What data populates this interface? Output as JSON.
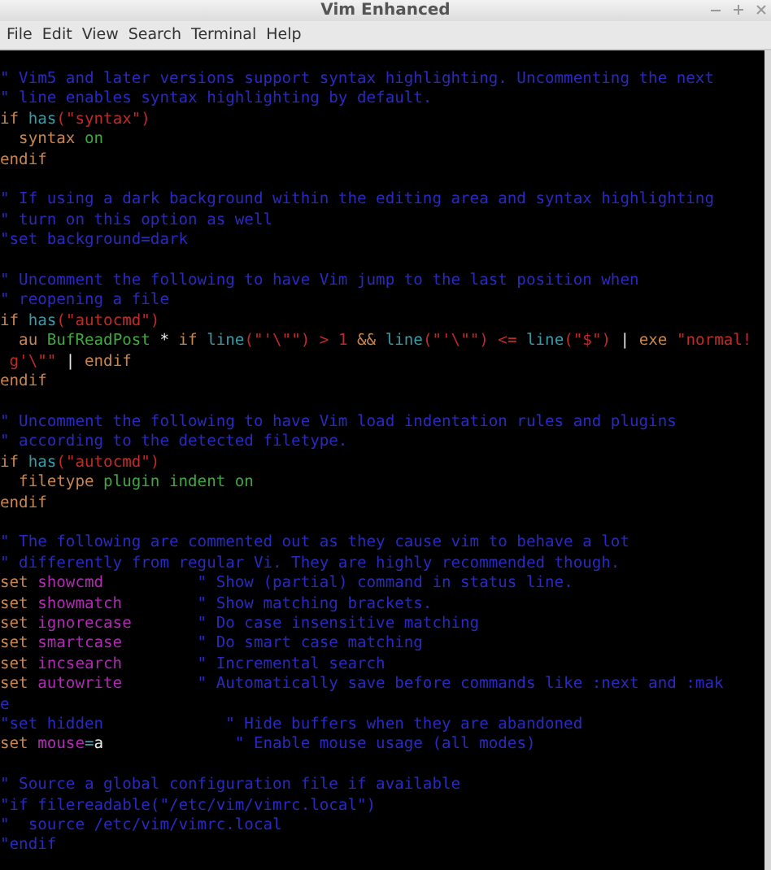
{
  "window": {
    "title": "Vim Enhanced"
  },
  "menu": [
    "File",
    "Edit",
    "View",
    "Search",
    "Terminal",
    "Help"
  ],
  "lines": [
    {
      "kind": "code",
      "tokens": [
        {
          "kind": "comment",
          "text": "\" Vim5 and later versions support syntax highlighting. Uncommenting the next"
        }
      ]
    },
    {
      "kind": "code",
      "tokens": [
        {
          "kind": "comment",
          "text": "\" line enables syntax highlighting by default."
        }
      ]
    },
    {
      "kind": "code",
      "tokens": [
        {
          "kind": "statement",
          "text": "if"
        },
        {
          "kind": "function",
          "text": " has"
        },
        {
          "kind": "string",
          "text": "(\"syntax\")"
        }
      ]
    },
    {
      "kind": "code",
      "tokens": [
        {
          "kind": "statement",
          "text": "  syntax"
        },
        {
          "kind": "constant",
          "text": " on"
        }
      ]
    },
    {
      "kind": "code",
      "tokens": [
        {
          "kind": "statement",
          "text": "endif"
        }
      ]
    },
    {
      "kind": "blank"
    },
    {
      "kind": "code",
      "tokens": [
        {
          "kind": "comment",
          "text": "\" If using a dark background within the editing area and syntax highlighting"
        }
      ]
    },
    {
      "kind": "code",
      "tokens": [
        {
          "kind": "comment",
          "text": "\" turn on this option as well"
        }
      ]
    },
    {
      "kind": "code",
      "tokens": [
        {
          "kind": "comment",
          "text": "\"set background=dark"
        }
      ]
    },
    {
      "kind": "blank"
    },
    {
      "kind": "code",
      "tokens": [
        {
          "kind": "comment",
          "text": "\" Uncomment the following to have Vim jump to the last position when"
        }
      ]
    },
    {
      "kind": "code",
      "tokens": [
        {
          "kind": "comment",
          "text": "\" reopening a file"
        }
      ]
    },
    {
      "kind": "code",
      "tokens": [
        {
          "kind": "statement",
          "text": "if"
        },
        {
          "kind": "function",
          "text": " has"
        },
        {
          "kind": "string",
          "text": "(\"autocmd\")"
        }
      ]
    },
    {
      "kind": "code",
      "tokens": [
        {
          "kind": "statement",
          "text": "  au"
        },
        {
          "kind": "constant",
          "text": " BufReadPost"
        },
        {
          "kind": "normal",
          "text": " *"
        },
        {
          "kind": "statement",
          "text": " if"
        },
        {
          "kind": "function",
          "text": " line"
        },
        {
          "kind": "string",
          "text": "(\"'\\\"\") > 1"
        },
        {
          "kind": "statement",
          "text": " &&"
        },
        {
          "kind": "function",
          "text": " line"
        },
        {
          "kind": "string",
          "text": "(\"'\\\"\") <="
        },
        {
          "kind": "function",
          "text": " line"
        },
        {
          "kind": "string",
          "text": "(\"$\")"
        },
        {
          "kind": "normal",
          "text": " |"
        },
        {
          "kind": "statement",
          "text": " exe"
        },
        {
          "kind": "string",
          "text": " \"normal!"
        }
      ]
    },
    {
      "kind": "code",
      "tokens": [
        {
          "kind": "string",
          "text": " g'\\\"\""
        },
        {
          "kind": "normal",
          "text": " |"
        },
        {
          "kind": "statement",
          "text": " endif"
        }
      ]
    },
    {
      "kind": "code",
      "tokens": [
        {
          "kind": "statement",
          "text": "endif"
        }
      ]
    },
    {
      "kind": "blank"
    },
    {
      "kind": "code",
      "tokens": [
        {
          "kind": "comment",
          "text": "\" Uncomment the following to have Vim load indentation rules and plugins"
        }
      ]
    },
    {
      "kind": "code",
      "tokens": [
        {
          "kind": "comment",
          "text": "\" according to the detected filetype."
        }
      ]
    },
    {
      "kind": "code",
      "tokens": [
        {
          "kind": "statement",
          "text": "if"
        },
        {
          "kind": "function",
          "text": " has"
        },
        {
          "kind": "string",
          "text": "(\"autocmd\")"
        }
      ]
    },
    {
      "kind": "code",
      "tokens": [
        {
          "kind": "statement",
          "text": "  filetype"
        },
        {
          "kind": "constant",
          "text": " plugin indent on"
        }
      ]
    },
    {
      "kind": "code",
      "tokens": [
        {
          "kind": "statement",
          "text": "endif"
        }
      ]
    },
    {
      "kind": "blank"
    },
    {
      "kind": "code",
      "tokens": [
        {
          "kind": "comment",
          "text": "\" The following are commented out as they cause vim to behave a lot"
        }
      ]
    },
    {
      "kind": "code",
      "tokens": [
        {
          "kind": "comment",
          "text": "\" differently from regular Vi. They are highly recommended though."
        }
      ]
    },
    {
      "kind": "code",
      "tokens": [
        {
          "kind": "statement",
          "text": "set"
        },
        {
          "kind": "option",
          "text": " showcmd"
        },
        {
          "kind": "comment",
          "text": "          \" Show (partial) command in status line."
        }
      ]
    },
    {
      "kind": "code",
      "tokens": [
        {
          "kind": "statement",
          "text": "set"
        },
        {
          "kind": "option",
          "text": " showmatch"
        },
        {
          "kind": "comment",
          "text": "        \" Show matching brackets."
        }
      ]
    },
    {
      "kind": "code",
      "tokens": [
        {
          "kind": "statement",
          "text": "set"
        },
        {
          "kind": "option",
          "text": " ignorecase"
        },
        {
          "kind": "comment",
          "text": "       \" Do case insensitive matching"
        }
      ]
    },
    {
      "kind": "code",
      "tokens": [
        {
          "kind": "statement",
          "text": "set"
        },
        {
          "kind": "option",
          "text": " smartcase"
        },
        {
          "kind": "comment",
          "text": "        \" Do smart case matching"
        }
      ]
    },
    {
      "kind": "code",
      "tokens": [
        {
          "kind": "statement",
          "text": "set"
        },
        {
          "kind": "option",
          "text": " incsearch"
        },
        {
          "kind": "comment",
          "text": "        \" Incremental search"
        }
      ]
    },
    {
      "kind": "code",
      "tokens": [
        {
          "kind": "statement",
          "text": "set"
        },
        {
          "kind": "option",
          "text": " autowrite"
        },
        {
          "kind": "comment",
          "text": "        \" Automatically save before commands like :next and :mak"
        }
      ]
    },
    {
      "kind": "code",
      "tokens": [
        {
          "kind": "comment",
          "text": "e"
        }
      ]
    },
    {
      "kind": "code",
      "tokens": [
        {
          "kind": "comment",
          "text": "\"set hidden             \" Hide buffers when they are abandoned"
        }
      ]
    },
    {
      "kind": "code",
      "tokens": [
        {
          "kind": "statement",
          "text": "set"
        },
        {
          "kind": "option",
          "text": " mouse"
        },
        {
          "kind": "function",
          "text": "="
        },
        {
          "kind": "normal",
          "text": "a"
        },
        {
          "kind": "comment",
          "text": "              \" Enable mouse usage (all modes)"
        }
      ]
    },
    {
      "kind": "blank"
    },
    {
      "kind": "code",
      "tokens": [
        {
          "kind": "comment",
          "text": "\" Source a global configuration file if available"
        }
      ]
    },
    {
      "kind": "code",
      "tokens": [
        {
          "kind": "comment",
          "text": "\"if filereadable(\"/etc/vim/vimrc.local\")"
        }
      ]
    },
    {
      "kind": "code",
      "tokens": [
        {
          "kind": "comment",
          "text": "\"  source /etc/vim/vimrc.local"
        }
      ]
    },
    {
      "kind": "code",
      "tokens": [
        {
          "kind": "comment",
          "text": "\"endif"
        }
      ]
    }
  ]
}
